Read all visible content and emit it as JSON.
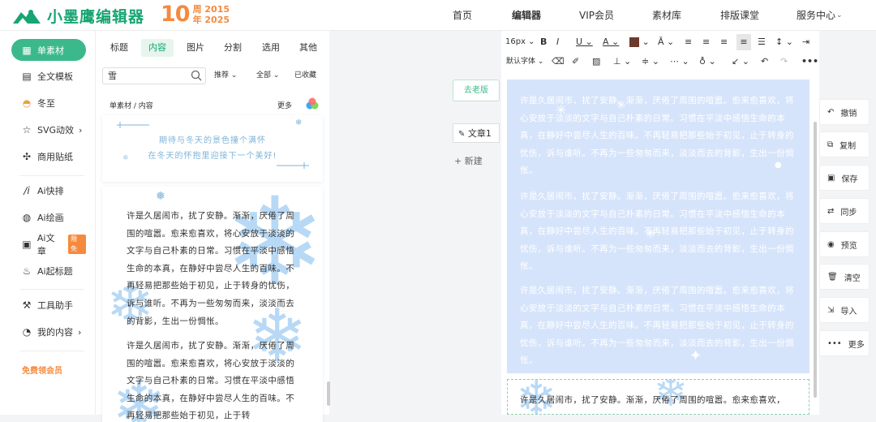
{
  "brand": {
    "name": "小墨鹰编辑器",
    "anniv_number": "10",
    "anniv_line1": "周 2015",
    "anniv_line2": "年 2025"
  },
  "nav": {
    "items": [
      "首页",
      "编辑器",
      "VIP会员",
      "素材库",
      "排版课堂",
      "服务中心"
    ],
    "active": "编辑器"
  },
  "sidebar": {
    "items": [
      {
        "label": "单素材",
        "icon": "grid-icon"
      },
      {
        "label": "全文模板",
        "icon": "layout-icon"
      },
      {
        "label": "冬至",
        "icon": "dumpling-icon"
      },
      {
        "label": "SVG动效",
        "icon": "star-icon",
        "has_chevron": true
      },
      {
        "label": "商用贴纸",
        "icon": "puzzle-icon"
      },
      {
        "label": "Ai快排",
        "icon": "ai-icon"
      },
      {
        "label": "Ai绘画",
        "icon": "palette-icon"
      },
      {
        "label": "Ai文章",
        "icon": "ai-article-icon",
        "badge": "限免"
      },
      {
        "label": "Ai起标题",
        "icon": "fire-icon"
      },
      {
        "label": "工具助手",
        "icon": "tools-icon"
      },
      {
        "label": "我的内容",
        "icon": "user-icon",
        "has_chevron": true
      }
    ],
    "promo": "免费领会员"
  },
  "panel": {
    "tabs": [
      "标题",
      "内容",
      "图片",
      "分割",
      "选用",
      "其他"
    ],
    "active_tab": "内容",
    "search_value": "雪",
    "filters": [
      "推荐",
      "全部",
      "已收藏"
    ],
    "breadcrumb": "单素材 / 内容",
    "more": "更多",
    "card1_line1": "期待与冬天的景色撞个满怀",
    "card1_line2": "在冬天的怀抱里迎接下一个美好!",
    "card2_para1": "许是久居闹市，扰了安静。渐渐，厌倦了周围的喧嚣。愈来愈喜欢，将心安放于淡淡的文字与自己朴素的日常。习惯在平淡中感悟生命的本真，在静好中尝尽人生的百味。不再轻易把那些始于初见，止于转身的忧伤，诉与谁听。不再为一些匆匆而来，淡淡而去的背影，生出一份惆怅。",
    "card2_para2": "许是久居闹市，扰了安静。渐渐，厌倦了周围的喧嚣。愈来愈喜欢，将心安放于淡淡的文字与自己朴素的日常。习惯在平淡中感悟生命的本真，在静好中尝尽人生的百味。不再轻易把那些始于初见，止于转"
  },
  "middle": {
    "old_version": "去老版",
    "doc_name": "文章1",
    "new_label": "新建"
  },
  "editor": {
    "font_size": "16px",
    "font_family": "默认字体",
    "para1": "许是久居闹市，扰了安静。渐渐，厌倦了周围的喧嚣。愈来愈喜欢，将心安放于淡淡的文字与自己朴素的日常。习惯在平淡中感悟生命的本真，在静好中尝尽人生的百味。不再轻易把那些始于初见，止于转身的忧伤，诉与谁听。不再为一些匆匆而来，淡淡而去的背影，生出一份惆怅。",
    "para2": "许是久居闹市，扰了安静。渐渐，厌倦了周围的喧嚣。愈来愈喜欢，将心安放于淡淡的文字与自己朴素的日常。习惯在平淡中感悟生命的本真，在静好中尝尽人生的百味。不再轻易把那些始于初见，止于转身的忧伤，诉与谁听。不再为一些匆匆而来，淡淡而去的背影，生出一份惆怅。",
    "para3": "许是久居闹市，扰了安静。渐渐，厌倦了周围的喧嚣。愈来愈喜欢，将心安放于淡淡的文字与自己朴素的日常。习惯在平淡中感悟生命的本真，在静好中尝尽人生的百味。不再轻易把那些始于初见，止于转身的忧伤，诉与谁听。不再为一些匆匆而来，淡淡而去的背影，生出一份惆怅。",
    "para4": "许是久居闹市，扰了安静。渐渐，厌倦了周围的喧嚣。愈来愈喜欢，"
  },
  "right_actions": [
    "撤销",
    "复制",
    "保存",
    "同步",
    "预览",
    "清空",
    "导入",
    "更多"
  ],
  "colors": {
    "brand_green": "#17a572",
    "accent_orange": "#f58a3e",
    "selection_blue": "#d6e4fb",
    "snow_blue": "#b8d9f5"
  }
}
